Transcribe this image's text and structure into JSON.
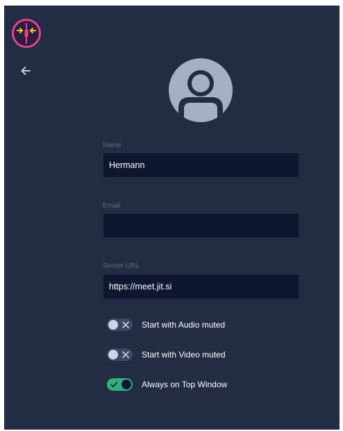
{
  "app": {
    "logo_icon": "jitsi-meet-logo-icon",
    "back_icon": "arrow-left-icon",
    "avatar_icon": "user-avatar-icon"
  },
  "form": {
    "name": {
      "label": "Name",
      "value": "Hermann"
    },
    "email": {
      "label": "Email",
      "value": ""
    },
    "server_url": {
      "label": "Server URL",
      "value": "https://meet.jit.si"
    }
  },
  "toggles": {
    "audio_muted": {
      "label": "Start with Audio muted",
      "checked": false
    },
    "video_muted": {
      "label": "Start with Video muted",
      "checked": false
    },
    "always_on_top": {
      "label": "Always on Top Window",
      "checked": true
    }
  },
  "colors": {
    "background": "#222d43",
    "input_background": "#0f1630",
    "toggle_on": "#31b07f",
    "toggle_off": "#3a4864",
    "logo_ring": "#e5418f",
    "logo_arrows": "#f6c33a"
  }
}
